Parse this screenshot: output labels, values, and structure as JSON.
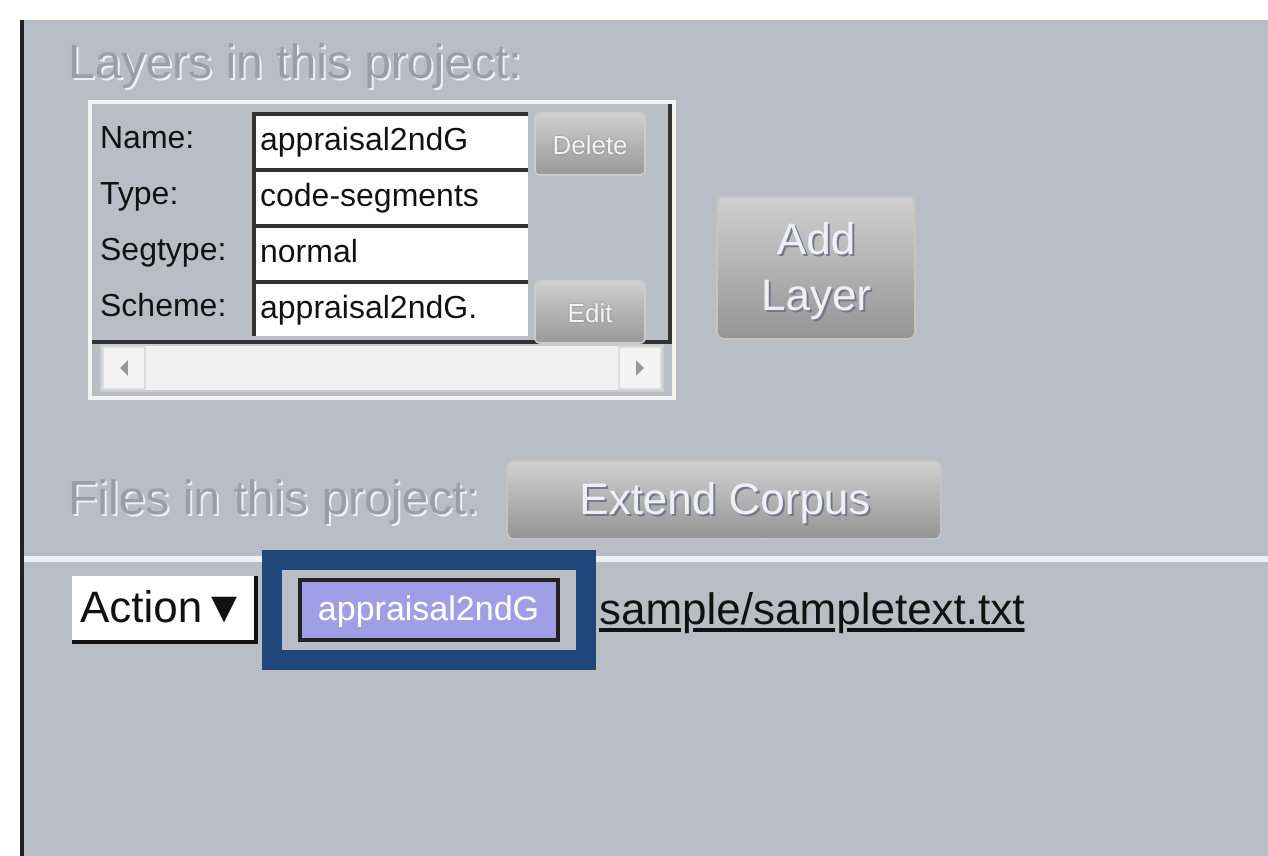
{
  "layers_section": {
    "title": "Layers in this project:",
    "fields": [
      {
        "label": "Name:",
        "value": "appraisal2ndG"
      },
      {
        "label": "Type:",
        "value": "code-segments"
      },
      {
        "label": "Segtype:",
        "value": "normal"
      },
      {
        "label": "Scheme:",
        "value": "appraisal2ndG."
      }
    ],
    "delete_button": "Delete",
    "edit_button": "Edit",
    "add_button": "Add Layer"
  },
  "files_section": {
    "title": "Files in this project:",
    "extend_button": "Extend Corpus",
    "files": [
      {
        "action": "Action▼",
        "layer_tag": "appraisal2ndG",
        "highlighted": true,
        "path": "sample/sampletext.txt"
      }
    ]
  }
}
